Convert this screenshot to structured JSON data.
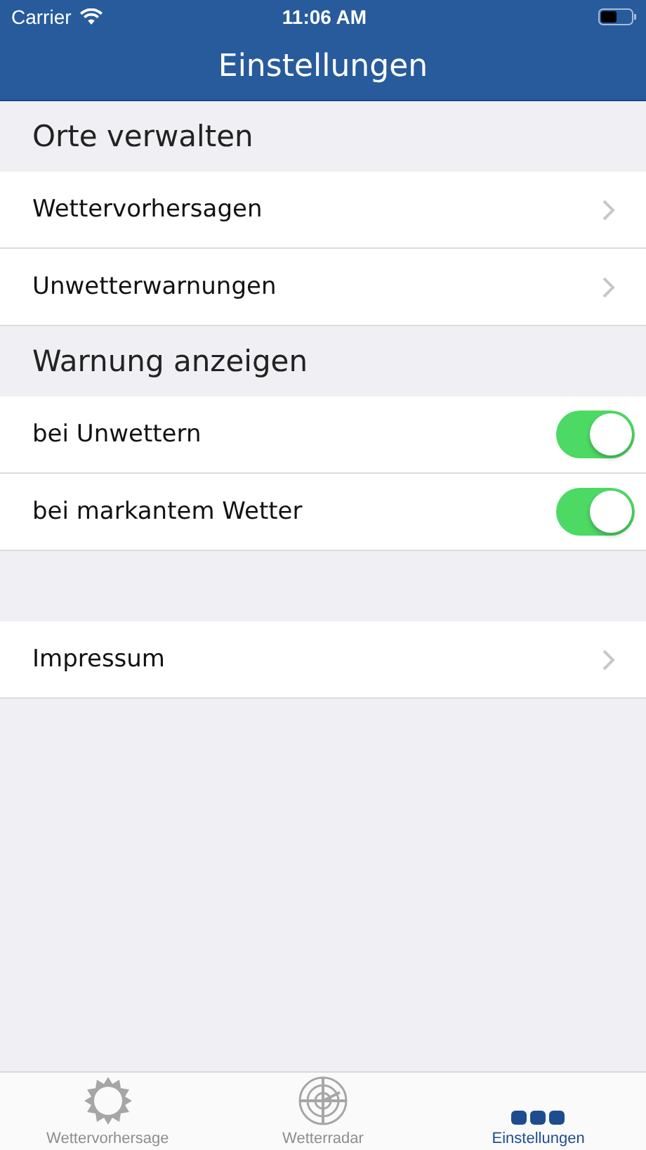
{
  "status_bar": {
    "carrier": "Carrier",
    "time": "11:06 AM"
  },
  "nav": {
    "title": "Einstellungen"
  },
  "sections": [
    {
      "title": "Orte verwalten",
      "items": [
        {
          "kind": "link",
          "label": "Wettervorhersagen"
        },
        {
          "kind": "link",
          "label": "Unwetterwarnungen"
        }
      ]
    },
    {
      "title": "Warnung anzeigen",
      "items": [
        {
          "kind": "toggle",
          "label": "bei Unwettern",
          "on": true
        },
        {
          "kind": "toggle",
          "label": "bei markantem Wetter",
          "on": true
        }
      ]
    },
    {
      "items": [
        {
          "kind": "link",
          "label": "Impressum"
        }
      ]
    }
  ],
  "tabs": [
    {
      "kind": "sun",
      "label": "Wettervorhersage",
      "selected": false
    },
    {
      "kind": "radar",
      "label": "Wetterradar",
      "selected": false
    },
    {
      "kind": "dots",
      "label": "Einstellungen",
      "selected": true
    }
  ]
}
